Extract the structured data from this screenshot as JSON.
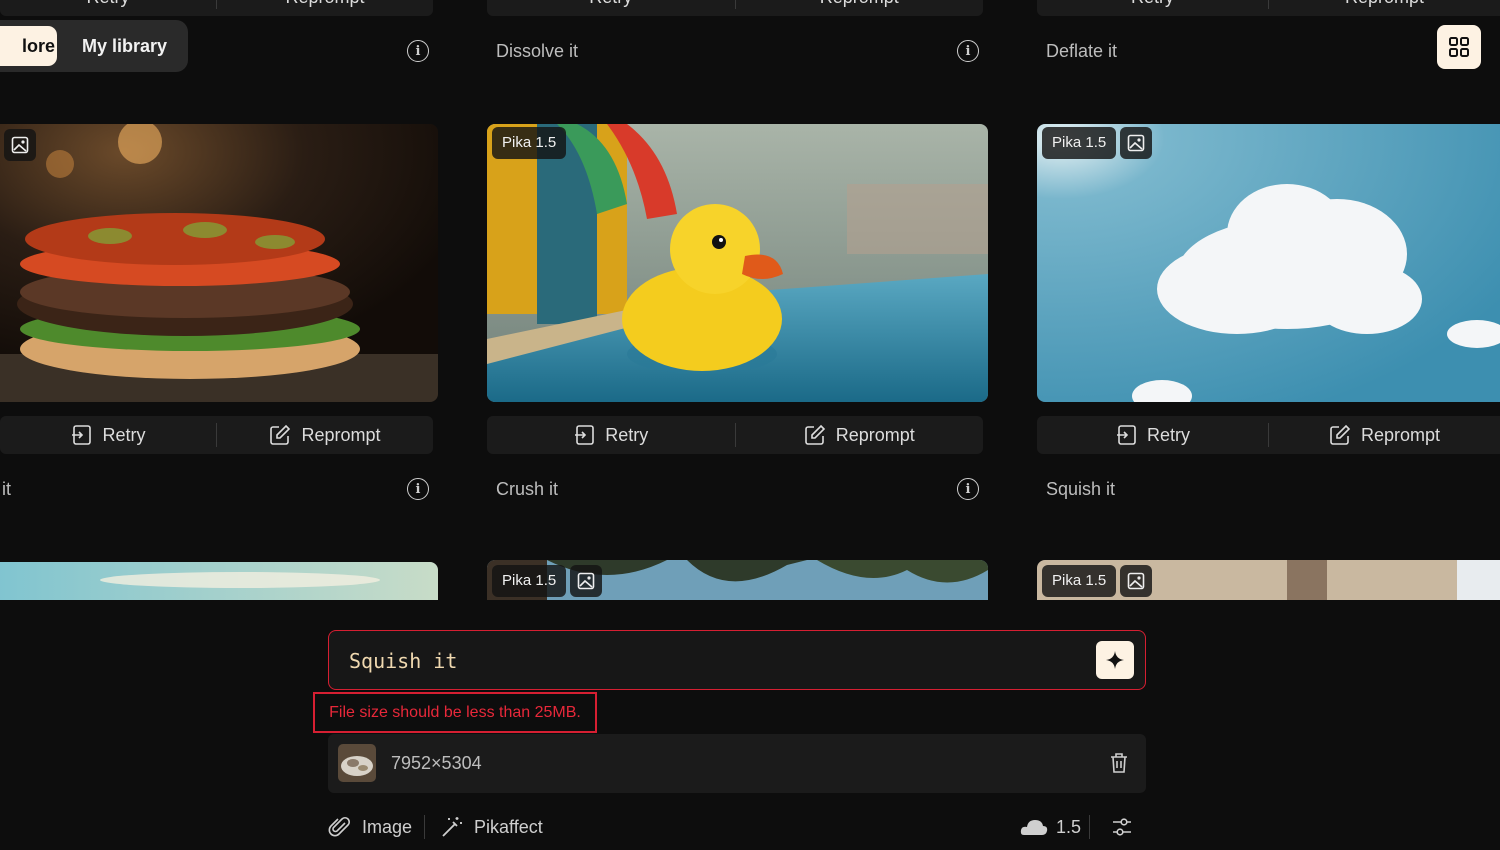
{
  "top_bar": {
    "explore_partial": "lore",
    "my_library": "My library"
  },
  "actions": {
    "retry": "Retry",
    "reprompt": "Reprompt"
  },
  "captions_row1": [
    "Dissolve it",
    "Deflate it"
  ],
  "captions_row2": [
    "it",
    "Crush it",
    "Squish it"
  ],
  "badge_model": "Pika 1.5",
  "prompt": {
    "value": "Squish it",
    "error": "File size should be less than 25MB."
  },
  "attachment": {
    "dimensions": "7952×5304"
  },
  "toolbar": {
    "image_label": "Image",
    "pikaffect_label": "Pikaffect",
    "model_version": "1.5"
  },
  "colors": {
    "accent_error": "#d61f32",
    "background": "#0d0d0d",
    "panel": "#1b1b1b",
    "cream": "#fdf2e3"
  }
}
